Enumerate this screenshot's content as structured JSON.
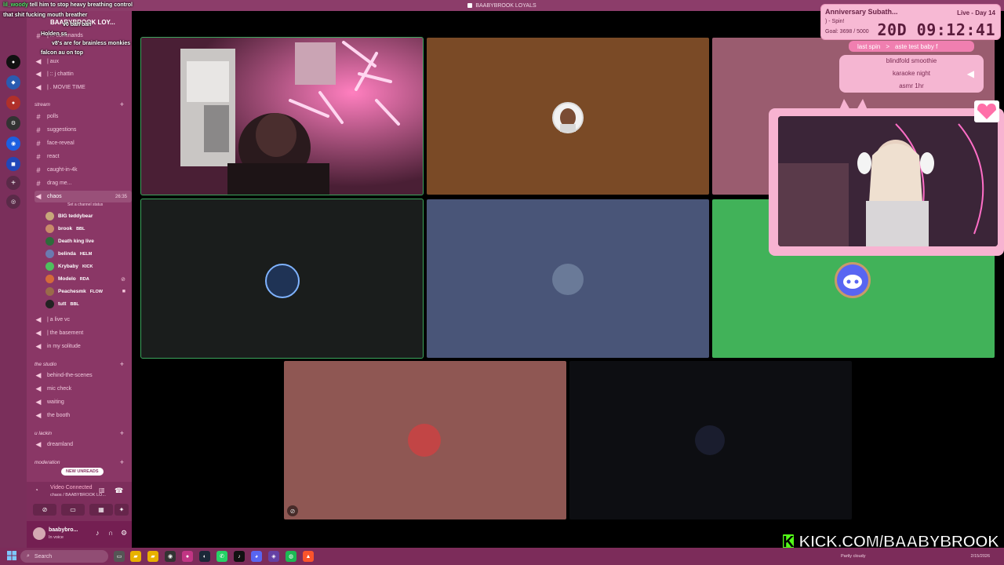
{
  "window_title": "BAABYBROOK LOYALS",
  "server_name": "BAABYBROOK LOY...",
  "chat_overlay": [
    {
      "user": "lil_woody",
      "text": "tell him to stop heavy breathing control"
    },
    {
      "user": "",
      "text": "that shit fucking mouth breather"
    },
    {
      "user": "",
      "text": "v0 bah bah"
    },
    {
      "user": "",
      "text": "Holden ss"
    },
    {
      "user": "",
      "text": "v8's are for brainless monkies"
    },
    {
      "user": "",
      "text": "falcon au on top"
    }
  ],
  "channels_top": [
    {
      "type": "text",
      "label": "| ... commands"
    },
    {
      "type": "voice",
      "label": "| aux"
    },
    {
      "type": "voice",
      "label": "| :: j chattin"
    },
    {
      "type": "voice",
      "label": "| . MOVIE TIME"
    }
  ],
  "category_stream": "stream",
  "channels_stream": [
    {
      "type": "text",
      "label": "polls"
    },
    {
      "type": "text",
      "label": "suggestions"
    },
    {
      "type": "text",
      "label": "face-reveal"
    },
    {
      "type": "text",
      "label": "react"
    },
    {
      "type": "text",
      "label": "caught-in-4k"
    },
    {
      "type": "text",
      "label": "drag me..."
    }
  ],
  "active_channel": {
    "label": "chaos",
    "time": "26:35",
    "status": "Set a channel status"
  },
  "voice_users": [
    {
      "name": "BIG teddybear",
      "badge": "",
      "color": "#c7a77a"
    },
    {
      "name": "brook",
      "badge": "BBL",
      "color": "#c98b6a"
    },
    {
      "name": "Death king live",
      "badge": "",
      "color": "#2e6b3b"
    },
    {
      "name": "belinda",
      "badge": "HELM",
      "color": "#6b7ab0"
    },
    {
      "name": "Krybaby",
      "badge": "KICK",
      "color": "#4fbf5e"
    },
    {
      "name": "Modelo",
      "badge": "RDA",
      "color": "#d46a3a"
    },
    {
      "name": "Peachesmk",
      "badge": "FLOW",
      "color": "#9a6a4a"
    },
    {
      "name": "tutt",
      "badge": "BBL",
      "color": "#222"
    }
  ],
  "channels_after": [
    {
      "type": "voice",
      "label": "| a live vc"
    },
    {
      "type": "voice",
      "label": "| the basement"
    },
    {
      "type": "voice",
      "label": "in my solitude"
    }
  ],
  "category_studio": "the studio",
  "channels_studio": [
    {
      "type": "voice",
      "label": "behind-the-scenes"
    },
    {
      "type": "voice",
      "label": "mic check"
    },
    {
      "type": "voice",
      "label": "waiting"
    },
    {
      "type": "voice",
      "label": "the booth"
    }
  ],
  "category_lackin": "u lackin",
  "channels_lackin": [
    {
      "type": "voice",
      "label": "dreamland"
    }
  ],
  "category_moderation": "moderation",
  "new_unreads": "NEW UNREADS",
  "voice_panel": {
    "title": "Video Connected",
    "subtitle": "chaos / BAABYBROOK LO..."
  },
  "user_panel": {
    "name": "baabybro...",
    "status": "In voice"
  },
  "sub_widget": {
    "title": "Anniversary Subath...",
    "live": "Live - Day 14",
    "spin": ") - Spin!",
    "goal": "Goal: 3698 / 5000",
    "timer": "20D 09:12:41"
  },
  "spin_bar": [
    "last spin",
    ">",
    "aste test baby f"
  ],
  "spin_list": [
    "blindfold smoothie",
    "karaoke night",
    "asmr 1hr"
  ],
  "kick_banner": "KICK.COM/BAABYBROOK",
  "taskbar": {
    "search": "Search",
    "weather": "Partly cloudy",
    "date": "2/15/2026"
  },
  "colors": {
    "sidebar": "#8a3766",
    "rail": "#7a2f5b",
    "tile_orange": "#7a4a26",
    "tile_dark": "#1a1d1c",
    "tile_slate": "#495578",
    "tile_green": "#41b259",
    "tile_rose": "#8f5753",
    "tile_mauve": "#9a5c6f",
    "kick_green": "#53fc18"
  }
}
